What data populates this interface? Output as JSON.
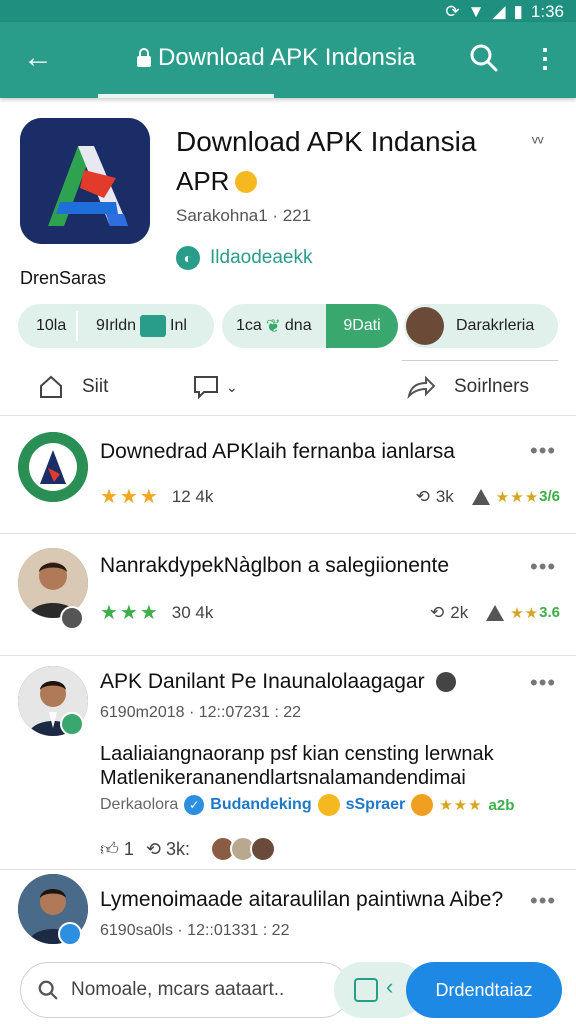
{
  "status_bar": {
    "time": "1:36"
  },
  "app_bar": {
    "title": "Download APK Indonsia",
    "back_label": "←",
    "more_label": "⋮"
  },
  "app": {
    "title": "Download APK Indansia",
    "subtitle": "APR",
    "version": "Sarakohna1 · 221",
    "developer": "Ildaodeaekk",
    "brand": "DrenSaras"
  },
  "chips": {
    "a_left": "10la",
    "a_right_1": "9Irldn",
    "a_right_2": "Inl",
    "b_text_1": "1ca",
    "b_text_2": "dna",
    "b_pill": "9Dati",
    "c_text": "Darakrleria"
  },
  "actions": {
    "share": "Siit",
    "right": "Soirlners"
  },
  "feed": [
    {
      "title": "Downedrad APKlaih fernanba ianlarsa",
      "rating_count": "12 4k",
      "repost_count": "3k",
      "mini_score": "3/6"
    },
    {
      "title": "NanrakdypekNàglbon a salegiionente",
      "rating_count": "30 4k",
      "repost_count": "2k",
      "mini_score": "3.6"
    },
    {
      "title": "APK Danilant Pe Inaunalolaagagar",
      "meta": "6190m2018 · 12::07231 : 22",
      "body_line1": "Laaliaiangnaoranp psf kian censting lerwnak",
      "body_line2": "Matlenikerananendlartsnalamandendimai",
      "tag_1": "Derkaolora",
      "tag_2": "Budandeking",
      "tag_3": "sSpraer",
      "tag_score": "a2b",
      "like_count": "1",
      "repost_count": "3k:"
    },
    {
      "title": "Lymenoimaade aitaraulilan paintiwna Aibe?",
      "meta": "6190sa0ls · 12::01331 : 22"
    }
  ],
  "bottom": {
    "search_placeholder": "Nomoale, mcars aataart..",
    "download_label": "Drdendtaiaz"
  },
  "colors": {
    "primary": "#2a9d8a",
    "accent_blue": "#1e88e5",
    "star_gold": "#f5a623",
    "star_green": "#3dae49"
  }
}
